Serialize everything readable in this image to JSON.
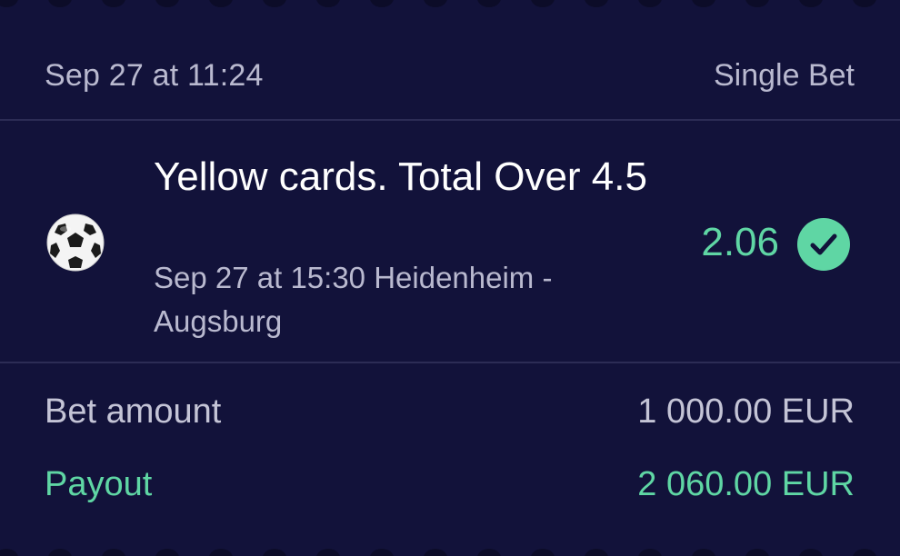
{
  "header": {
    "placed_at": "Sep 27 at 11:24",
    "bet_type": "Single Bet"
  },
  "selection": {
    "sport_icon": "soccer-ball-icon",
    "market": "Yellow cards. Total Over 4.5",
    "event": "Sep 27 at 15:30 Heidenheim - Augsburg",
    "odds": "2.06",
    "status_icon": "check-circle-icon"
  },
  "summary": {
    "amount_label": "Bet amount",
    "amount_value": "1 000.00 EUR",
    "payout_label": "Payout",
    "payout_value": "2 060.00 EUR"
  },
  "colors": {
    "background": "#12123a",
    "accent_green": "#5fd6a4",
    "muted_text": "#b9b9cf",
    "divider": "#2c2c55"
  }
}
